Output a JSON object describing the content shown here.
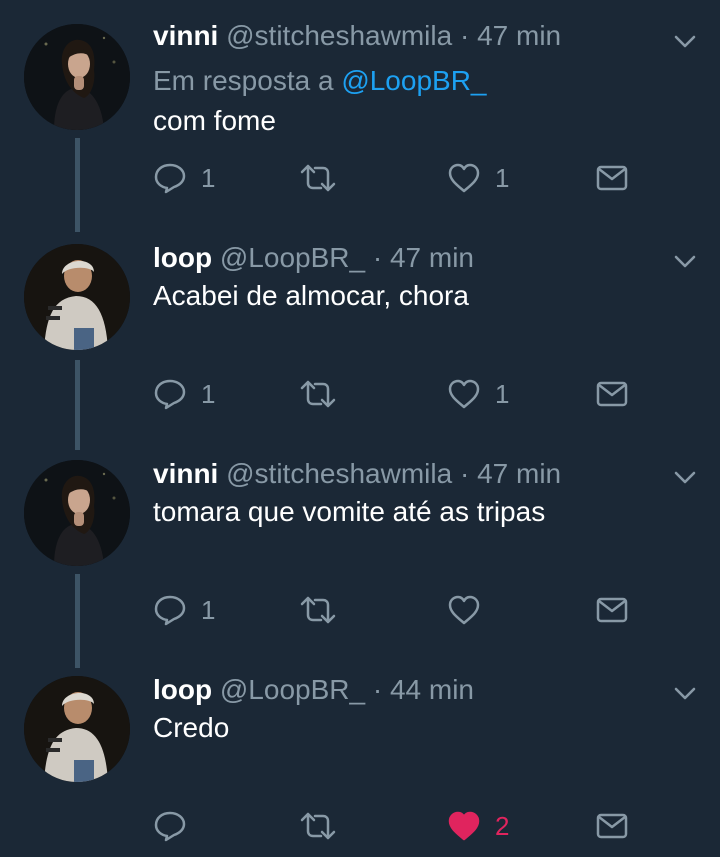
{
  "tweets": [
    {
      "name": "vinni",
      "handle": "@stitcheshawmila",
      "time": "· 47 min",
      "reply_prefix": "Em resposta a",
      "reply_handle": "@LoopBR_",
      "text": "com fome",
      "replies": "1",
      "retweets": "",
      "likes": "1",
      "liked": false
    },
    {
      "name": "loop",
      "handle": "@LoopBR_",
      "time": "· 47 min",
      "text": "Acabei de almocar, chora",
      "replies": "1",
      "retweets": "",
      "likes": "1",
      "liked": false
    },
    {
      "name": "vinni",
      "handle": "@stitcheshawmila",
      "time": "· 47 min",
      "text": "tomara que vomite até as tripas",
      "replies": "1",
      "retweets": "",
      "likes": "",
      "liked": false
    },
    {
      "name": "loop",
      "handle": "@LoopBR_",
      "time": "· 44 min",
      "text": "Credo",
      "replies": "",
      "retweets": "",
      "likes": "2",
      "liked": true
    }
  ],
  "colors": {
    "background": "#1b2836",
    "muted": "#8899a6",
    "link": "#1da1f2",
    "like": "#e0245e",
    "thread_line": "#3d5466"
  },
  "icons": [
    "reply-icon",
    "retweet-icon",
    "like-icon",
    "message-icon",
    "chevron-down-icon"
  ]
}
